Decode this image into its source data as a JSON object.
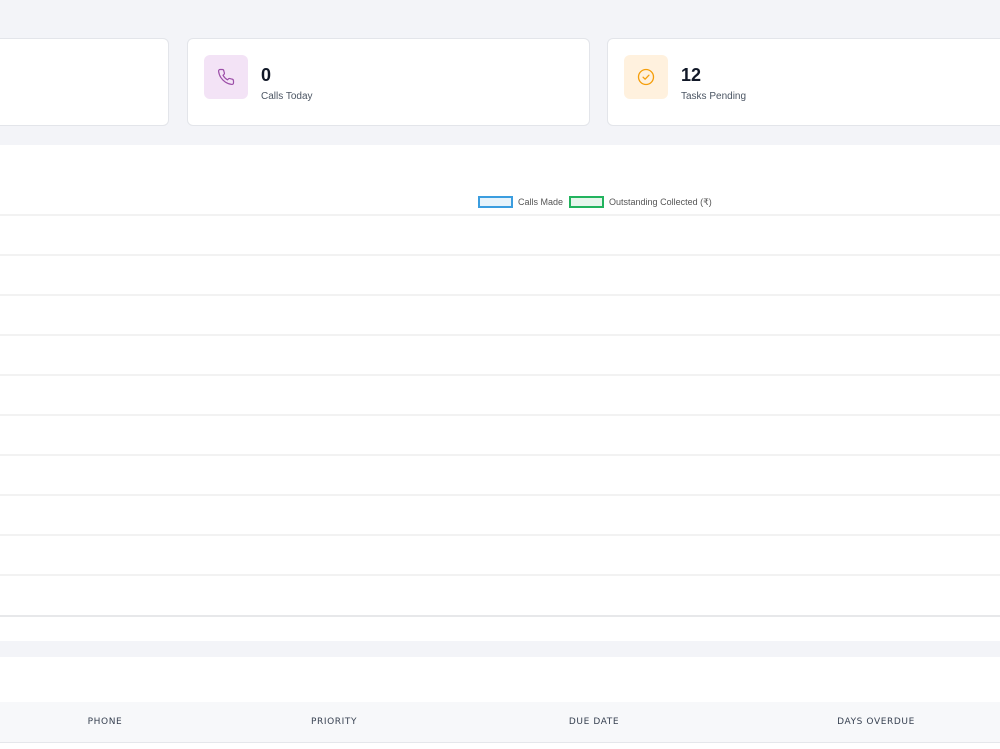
{
  "stats": [
    {
      "value": "0",
      "label": "Calls Today",
      "icon": "phone-icon",
      "icon_color": "#9c4ea8",
      "bg_color": "#f3e3f6"
    },
    {
      "value": "12",
      "label": "Tasks Pending",
      "icon": "check-circle-icon",
      "icon_color": "#f59e0b",
      "bg_color": "#fff1de"
    }
  ],
  "chart_data": {
    "type": "line",
    "series": [
      {
        "name": "Calls Made",
        "color": "#3b9ddf",
        "values": []
      },
      {
        "name": "Outstanding Collected (₹)",
        "color": "#22b35e",
        "values": []
      }
    ],
    "legend_position": "top",
    "grid": true
  },
  "table": {
    "columns": [
      "PHONE",
      "PRIORITY",
      "DUE DATE",
      "DAYS OVERDUE"
    ]
  }
}
